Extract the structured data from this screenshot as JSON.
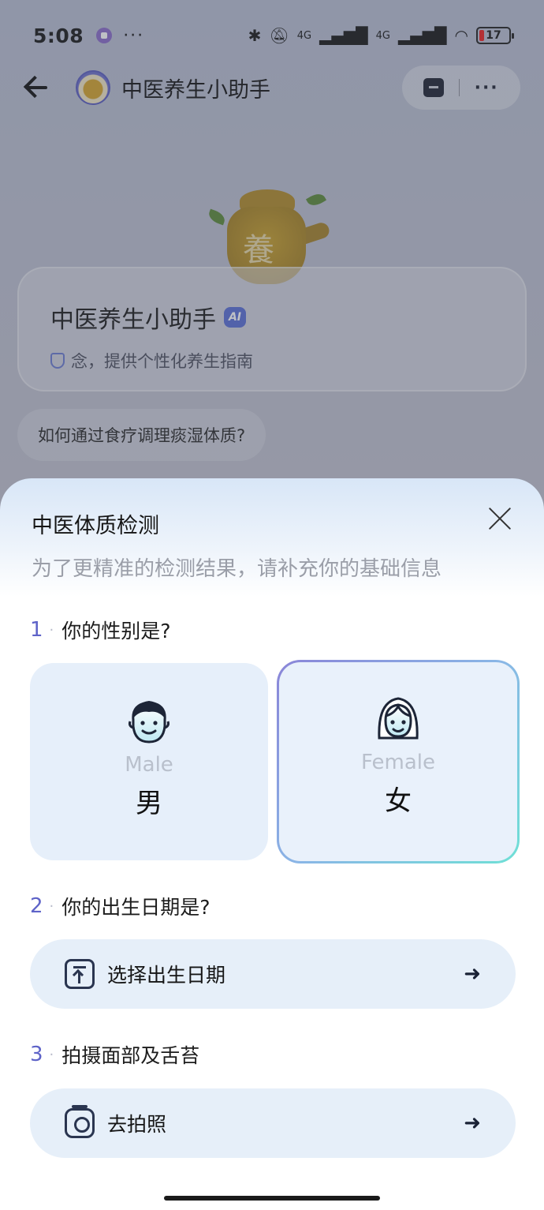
{
  "status_bar": {
    "time": "5:08",
    "more": "···",
    "network_left": "4G",
    "network_right": "4G",
    "battery": "17"
  },
  "nav": {
    "title": "中医养生小助手",
    "more": "···"
  },
  "bot_card": {
    "name": "中医养生小助手",
    "ai_badge": "AI",
    "description": "念，提供个性化养生指南",
    "teapot_char": "養"
  },
  "suggestion": {
    "text": "如何通过食疗调理痰湿体质?"
  },
  "sheet": {
    "title": "中医体质检测",
    "subtitle": "为了更精准的检测结果，请补充你的基础信息",
    "q1": {
      "num": "1",
      "text": "你的性别是?"
    },
    "gender": {
      "male": {
        "en": "Male",
        "zh": "男"
      },
      "female": {
        "en": "Female",
        "zh": "女"
      },
      "selected": "female"
    },
    "q2": {
      "num": "2",
      "text": "你的出生日期是?"
    },
    "birth_button": {
      "label": "选择出生日期",
      "arrow": "➜"
    },
    "q3": {
      "num": "3",
      "text": "拍摄面部及舌苔"
    },
    "photo_button": {
      "label": "去拍照",
      "arrow": "➜"
    }
  },
  "colors": {
    "accent": "#5e63c8",
    "card_bg": "#e6effa",
    "selected_border_start": "#8a85d8",
    "selected_border_end": "#6fe0d6"
  }
}
